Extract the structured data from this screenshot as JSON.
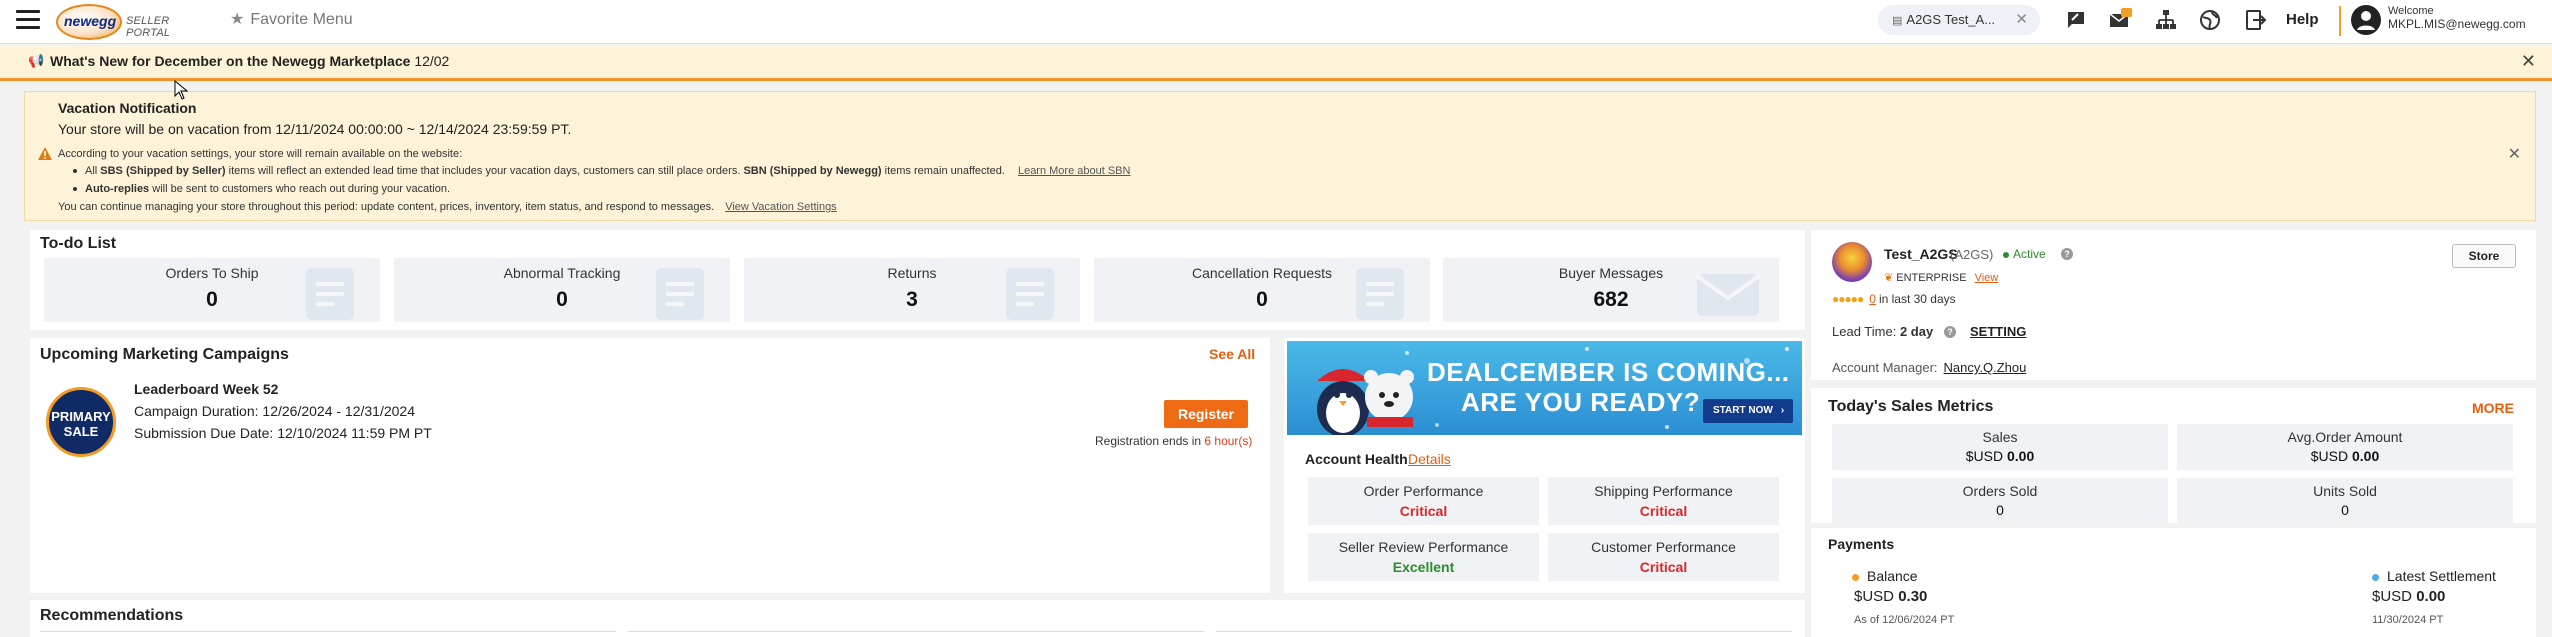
{
  "header": {
    "logo_text": "newegg",
    "portal_label": "SELLER PORTAL",
    "favorite_menu": "Favorite Menu",
    "store_pill": "A2GS  Test_A...",
    "help": "Help",
    "welcome": "Welcome",
    "email": "MKPL.MIS@newegg.com",
    "mail_badge": "9+"
  },
  "news": {
    "title": "What's New for December on the Newegg Marketplace",
    "date": "12/02"
  },
  "vacation": {
    "title": "Vacation Notification",
    "subtitle": "Your store will be on vacation from 12/11/2024 00:00:00 ~ 12/14/2024 23:59:59 PT.",
    "intro": "According to your vacation settings, your store will remain available on the website:",
    "bullet1_pre": "All ",
    "bullet1_b1": "SBS (Shipped by Seller)",
    "bullet1_mid": " items will reflect an extended lead time that includes your vacation days, customers can still place orders. ",
    "bullet1_b2": "SBN (Shipped by Newegg)",
    "bullet1_post": " items remain unaffected.",
    "bullet1_link": "Learn More about SBN",
    "bullet2_b": "Auto-replies",
    "bullet2_text": " will be sent to customers who reach out during your vacation.",
    "footer_text": "You can continue managing your store throughout this period: update content, prices, inventory, item status, and respond to messages.",
    "footer_link": "View Vacation Settings"
  },
  "todo": {
    "title": "To-do List",
    "cards": [
      {
        "label": "Orders To Ship",
        "value": "0"
      },
      {
        "label": "Abnormal Tracking",
        "value": "0"
      },
      {
        "label": "Returns",
        "value": "3"
      },
      {
        "label": "Cancellation Requests",
        "value": "0"
      },
      {
        "label": "Buyer Messages",
        "value": "682"
      }
    ]
  },
  "marketing": {
    "title": "Upcoming Marketing Campaigns",
    "see_all": "See All",
    "badge_l1": "PRIMARY",
    "badge_l2": "SALE",
    "campaign_name": "Leaderboard Week 52",
    "duration_label": "Campaign Duration:",
    "duration": "12/26/2024 - 12/31/2024",
    "due_label": "Submission Due Date:",
    "due": "12/10/2024 11:59 PM PT",
    "register": "Register",
    "reg_ends_pre": "Registration ends in ",
    "reg_ends_hours": "6 hour(s)"
  },
  "banner": {
    "line1": "DEALCEMBER IS COMING...",
    "line2": "ARE YOU READY?",
    "cta": "START NOW"
  },
  "account_health": {
    "title": "Account Health",
    "details": "Details",
    "items": [
      {
        "name": "Order Performance",
        "status": "Critical"
      },
      {
        "name": "Shipping Performance",
        "status": "Critical"
      },
      {
        "name": "Seller Review Performance",
        "status": "Excellent"
      },
      {
        "name": "Customer Performance",
        "status": "Critical"
      }
    ]
  },
  "store": {
    "name": "Test_A2GS",
    "id": "(A2GS)",
    "status": "Active",
    "store_button": "Store",
    "tier": "ENTERPRISE",
    "view": "View",
    "rating_count": "0",
    "rating_period": "in last 30 days",
    "lead_time_label": "Lead Time:",
    "lead_time_value": "2 day",
    "setting": "SETTING",
    "account_manager_label": "Account Manager:",
    "account_manager": "Nancy.Q.Zhou"
  },
  "sales": {
    "title": "Today's Sales Metrics",
    "more": "MORE",
    "metrics": [
      {
        "name": "Sales",
        "prefix": "$USD ",
        "value": "0.00"
      },
      {
        "name": "Avg.Order Amount",
        "prefix": "$USD ",
        "value": "0.00"
      },
      {
        "name": "Orders Sold",
        "prefix": "",
        "value": "0"
      },
      {
        "name": "Units Sold",
        "prefix": "",
        "value": "0"
      }
    ]
  },
  "payments": {
    "title": "Payments",
    "balance_label": "Balance",
    "balance_prefix": "$USD ",
    "balance_value": "0.30",
    "balance_date": "As of 12/06/2024 PT",
    "settlement_label": "Latest Settlement",
    "settlement_prefix": "$USD ",
    "settlement_value": "0.00",
    "settlement_date": "11/30/2024 PT"
  },
  "recommendations": {
    "title": "Recommendations"
  },
  "colors": {
    "accent": "#ee6a13",
    "critical": "#d82a2a",
    "excellent": "#2d8a2d",
    "notice_bg": "#fdf3d8"
  }
}
